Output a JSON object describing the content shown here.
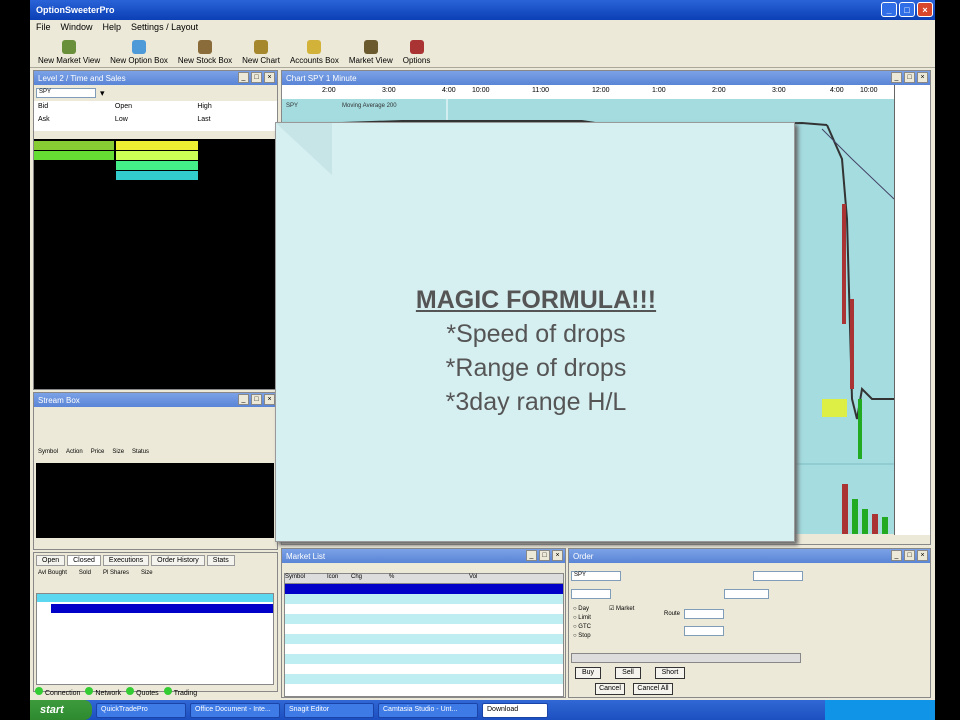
{
  "window": {
    "title": "OptionSweeterPro"
  },
  "menu": [
    "File",
    "Window",
    "Help",
    "Settings / Layout"
  ],
  "toolbar": [
    {
      "label": "New Market View",
      "icon": "market-icon"
    },
    {
      "label": "New Option Box",
      "icon": "option-icon"
    },
    {
      "label": "New Stock Box",
      "icon": "stock-icon"
    },
    {
      "label": "New Chart",
      "icon": "chart-icon"
    },
    {
      "label": "Accounts Box",
      "icon": "accounts-icon"
    },
    {
      "label": "Market View",
      "icon": "view-icon"
    },
    {
      "label": "Options",
      "icon": "settings-icon"
    }
  ],
  "level2": {
    "title": "Level 2 / Time and Sales",
    "symbol": "SPY",
    "quote_labels": [
      "Bid",
      "Ask",
      "Open",
      "Low",
      "High",
      "Last"
    ]
  },
  "news": {
    "title": "Stream Box",
    "tabs": [
      "Symbol",
      "Action",
      "Price",
      "Size",
      "Status"
    ]
  },
  "account": {
    "tabs": [
      "Open",
      "Closed",
      "Executions",
      "Order History",
      "Stats"
    ],
    "columns": [
      "Avl Bought",
      "Sold",
      "Pl Shares",
      "Size"
    ],
    "statusbar": [
      "Connection",
      "Network",
      "Quotes",
      "Trading"
    ]
  },
  "chart": {
    "title": "Chart SPY 1 Minute",
    "time_ticks": [
      "2:00",
      "3:00",
      "4:00",
      "10:00",
      "11:00",
      "12:00",
      "1:00",
      "2:00",
      "3:00",
      "4:00",
      "10:00"
    ],
    "symbol": "SPY",
    "ma_label": "Moving Average 200"
  },
  "slide": {
    "heading": "MAGIC FORMULA!!!",
    "bullets": [
      "*Speed of drops",
      "*Range of drops",
      "*3day range H/L"
    ]
  },
  "market_list": {
    "title": "Market List",
    "columns": [
      "Symbol",
      "Icon",
      "Chg",
      "%",
      "Vol"
    ]
  },
  "order_entry": {
    "title": "Order",
    "symbol": "SPY",
    "options": [
      "Day",
      "Limit",
      "Market",
      "Route",
      "GTC",
      "Stop"
    ],
    "buttons": [
      "Buy",
      "Sell",
      "Short",
      "Cancel",
      "Cancel All"
    ]
  },
  "taskbar": {
    "start": "start",
    "tasks": [
      "QuickTradePro",
      "Office Document - Inte...",
      "Snagit Editor",
      "Camtasia Studio - Unt..."
    ],
    "tray_label": "Download"
  },
  "colors": {
    "chart_bg": "#a4dce0",
    "slide_bg": "#d6eff1",
    "accent": "#0b3fb5",
    "selected": "#0000c8"
  }
}
